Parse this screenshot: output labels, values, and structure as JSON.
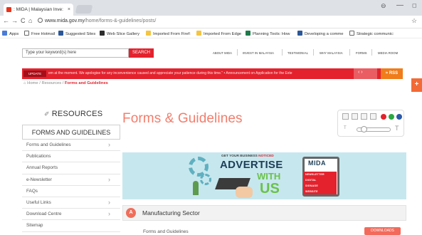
{
  "browser": {
    "tab_title": ": MIDA | Malaysian Inve:",
    "tab_close": "×",
    "profile_glyph": "⊖",
    "minimize_glyph": "—",
    "maximize_glyph": "◻",
    "back_glyph": "←",
    "forward_glyph": "→",
    "reload_glyph": "C",
    "home_glyph": "⌂",
    "url_host": "www.mida.gov.my",
    "url_path": "/home/forms-&-guidelines/posts/",
    "star_glyph": "☆",
    "bookmarks": [
      {
        "label": "Apps",
        "color": "#4a7bd6"
      },
      {
        "label": "Free Hotmail",
        "color": "#ffffff"
      },
      {
        "label": "Suggested Sites",
        "color": "#2b5797"
      },
      {
        "label": "Web Slice Gallery",
        "color": "#2b2b2b"
      },
      {
        "label": "Imported From Firef:",
        "color": "#f4c542"
      },
      {
        "label": "Imported From Edge",
        "color": "#f4c542"
      },
      {
        "label": "Planning Tools: How",
        "color": "#1e7a4a"
      },
      {
        "label": "Developing a comme",
        "color": "#2b5797"
      },
      {
        "label": "Strategic communic:",
        "color": "#ffffff"
      }
    ]
  },
  "site": {
    "search_placeholder": "Type your keyword(s) here",
    "search_button": "SEARCH",
    "top_nav": [
      "ABOUT MIDA",
      "INVEST IN MALAYSIA",
      "TESTIMONIAL",
      "WHY MALAYSIA",
      "FORMS",
      "MEDIA ROOM"
    ],
    "update_badge": "UPDATE",
    "ticker_text": "em at the moment. We apologise for any inconvenience caused and appreciate your patience during this time.\"  •  Announcement on Application for the Exte",
    "ticker_arrows": "‹  ›",
    "rss_label": "RSS",
    "side_tab": "+",
    "breadcrumb": {
      "home": "Home",
      "sep": " / ",
      "resources": "Resources",
      "current": "Forms and Guidelines"
    }
  },
  "sidebar": {
    "title": "RESOURCES",
    "title_icon": "tag-icon",
    "active_section": "FORMS AND GUIDELINES",
    "items": [
      {
        "label": "Forms and Guidelines",
        "chevron": true
      },
      {
        "label": "Publications",
        "chevron": false
      },
      {
        "label": "Annual Reports",
        "chevron": false
      },
      {
        "label": "e-Newsletter",
        "chevron": true
      },
      {
        "label": "FAQs",
        "chevron": false
      },
      {
        "label": "Useful Links",
        "chevron": true
      },
      {
        "label": "Download Centre",
        "chevron": true
      },
      {
        "label": "Sitemap",
        "chevron": false
      }
    ],
    "chevron_glyph": "›"
  },
  "main": {
    "page_title": "Forms & Guidelines",
    "a11y": {
      "small_t": "T",
      "big_t": "T",
      "dot_colors": [
        "#e3222d",
        "#2aa841",
        "#2b5aa6"
      ]
    },
    "banner": {
      "tag_prefix": "GET YOUR BUSINESS ",
      "tag_red": "NOTICED",
      "advertise": "ADVERTISE",
      "with": "WITH",
      "us": "US",
      "logo": "MIDA",
      "red_lines": [
        "NEWSLETTER",
        "DIGITAL",
        "SIGNAGE",
        "WEBSITE"
      ]
    },
    "sector": {
      "badge": "A",
      "title": "Manufacturing Sector"
    },
    "row": {
      "label": "Forms and Guidelines",
      "download": "DOWNLOADS"
    }
  }
}
